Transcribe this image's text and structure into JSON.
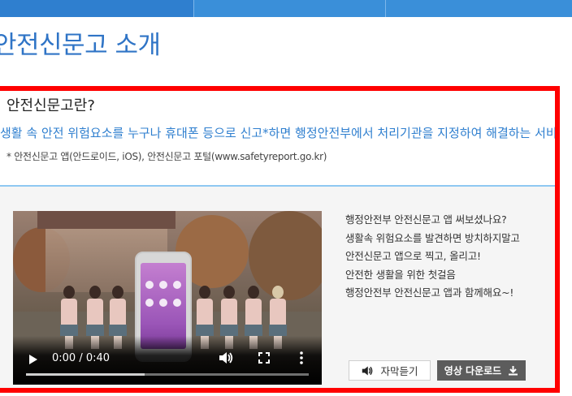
{
  "page": {
    "title": "안전신문고 소개"
  },
  "intro": {
    "question": "안전신문고란?",
    "description": "생활 속 안전 위험요소를 누구나 휴대폰 등으로 신고*하면 행정안전부에서 처리기관을 지정하여 해결하는 서비스",
    "note": "* 안전신문고 앱(안드로이드, iOS), 안전신문고 포털(www.safetyreport.go.kr)"
  },
  "video": {
    "current_time": "0:00",
    "duration": "0:40",
    "time_display": "0:00 / 0:40",
    "buffered_fraction": 0.42
  },
  "description_lines": [
    "행정안전부 안전신문고 앱 써보셨나요?",
    "생활속 위험요소를 발견하면 방치하지말고",
    "안전신문고 앱으로 찍고, 올리고!",
    "안전한 생활을 위한 첫걸음",
    "행정안전부 안전신문고 앱과 함께해요~!"
  ],
  "buttons": {
    "subtitle_listen": "자막듣기",
    "video_download": "영상 다운로드"
  },
  "colors": {
    "accent": "#2f74c6",
    "nav": "#3a8fd9",
    "highlight_border": "#ff0000",
    "divider": "#8ec8f2"
  },
  "icons": {
    "speaker": "speaker-icon",
    "download": "download-icon"
  }
}
